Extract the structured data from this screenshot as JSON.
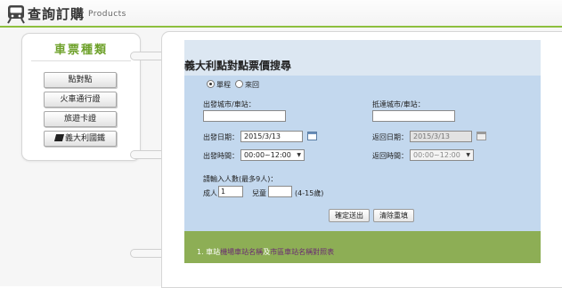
{
  "header": {
    "title": "查詢訂購",
    "subtitle": "Products"
  },
  "categories": {
    "title": "車票種類",
    "items": [
      {
        "label": "點對點"
      },
      {
        "label": "火車通行證"
      },
      {
        "label": "旅遊卡證"
      },
      {
        "label": "義大利國鐵",
        "icon": "flag-icon"
      }
    ]
  },
  "form": {
    "title": "義大利點對點票價搜尋",
    "trip_type": {
      "options": [
        "單程",
        "來回"
      ],
      "selected": "單程"
    },
    "departure_city_label": "出發城市/車站：",
    "departure_city_value": "",
    "arrival_city_label": "抵達城市/車站：",
    "arrival_city_value": "",
    "departure_date_label": "出發日期：",
    "departure_date_value": "2015/3/13",
    "return_date_label": "返回日期：",
    "return_date_value": "2015/3/13",
    "departure_time_label": "出發時間：",
    "departure_time_value": "00:00~12:00",
    "return_time_label": "返回時間：",
    "return_time_value": "00:00~12:00",
    "passengers_label": "請輸入人數(最多9人)：",
    "adult_label": "成人",
    "adult_value": "1",
    "child_label": "兒童",
    "child_value": "",
    "child_age_note": "(4-15歲)",
    "submit_label": "確定送出",
    "reset_label": "清除重填"
  },
  "notes": {
    "prefix": "1. 車站",
    "link1": "機場車站名稱",
    "mid": "及",
    "link2": "市區車站名稱對照表"
  },
  "colors": {
    "accent_green": "#8dbf3e",
    "form_blue": "#c3d8ee",
    "note_green": "#8dae55"
  }
}
